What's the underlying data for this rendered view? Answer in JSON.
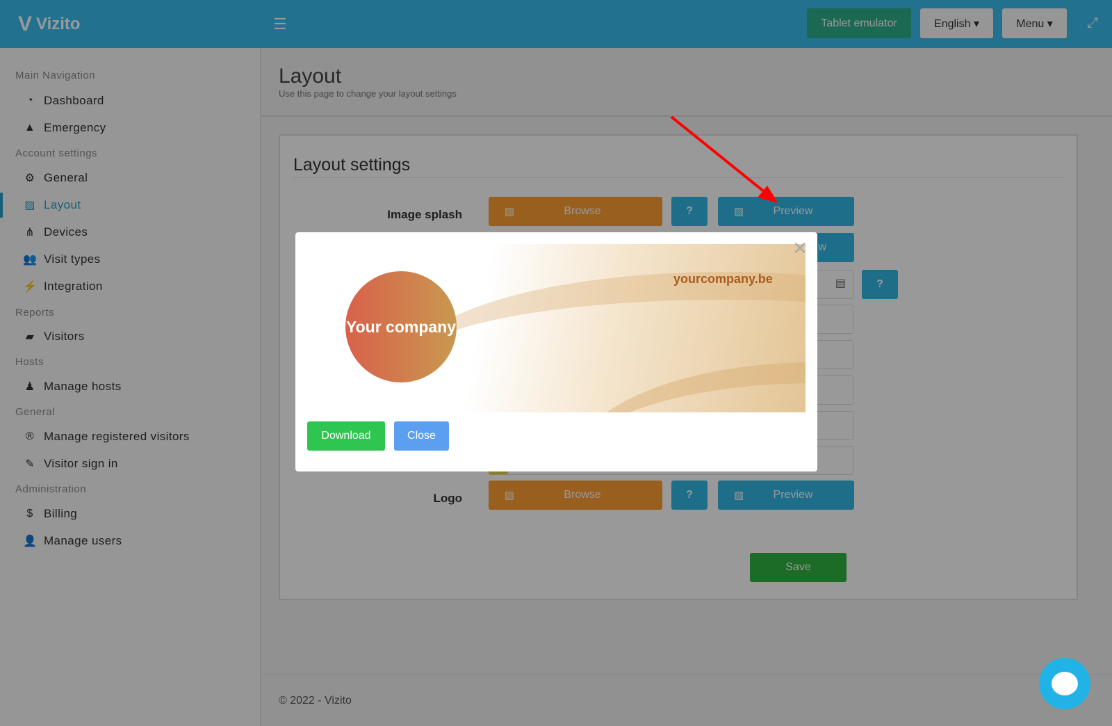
{
  "header": {
    "brand": "Vizito",
    "tablet_emulator": "Tablet emulator",
    "language": "English ▾",
    "menu": "Menu ▾"
  },
  "sidebar": {
    "sections": [
      "Main Navigation",
      "Account settings",
      "Reports",
      "Hosts",
      "General",
      "Administration"
    ],
    "items": [
      {
        "label": "Dashboard",
        "icon": "dashboard-icon"
      },
      {
        "label": "Emergency",
        "icon": "warning-icon"
      },
      {
        "label": "General",
        "icon": "gear-icon"
      },
      {
        "label": "Layout",
        "icon": "image-icon",
        "active": true
      },
      {
        "label": "Devices",
        "icon": "sitemap-icon"
      },
      {
        "label": "Visit types",
        "icon": "users-icon"
      },
      {
        "label": "Integration",
        "icon": "plug-icon"
      },
      {
        "label": "Visitors",
        "icon": "book-icon"
      },
      {
        "label": "Manage hosts",
        "icon": "host-icon"
      },
      {
        "label": "Manage registered visitors",
        "icon": "registered-icon"
      },
      {
        "label": "Visitor sign in",
        "icon": "pencil-icon"
      },
      {
        "label": "Billing",
        "icon": "dollar-icon"
      },
      {
        "label": "Manage users",
        "icon": "user-plus-icon"
      }
    ]
  },
  "page": {
    "title": "Layout",
    "subtitle": "Use this page to change your layout settings",
    "card_title": "Layout settings",
    "rows": {
      "image_splash": "Image splash",
      "logo": "Logo"
    },
    "browse": "Browse",
    "help": "?",
    "preview": "Preview",
    "preview_partial": "w",
    "save": "Save"
  },
  "modal": {
    "company": "Your company",
    "url": "yourcompany.be",
    "download": "Download",
    "close": "Close"
  },
  "footer": "© 2022 - Vizito",
  "colors": {
    "header": "#37bdee",
    "browse": "#ff9f33",
    "preview": "#33b8e6",
    "save": "#30b340",
    "download": "#2ec551",
    "close": "#5c9ff0",
    "arrow": "#ff0000"
  }
}
